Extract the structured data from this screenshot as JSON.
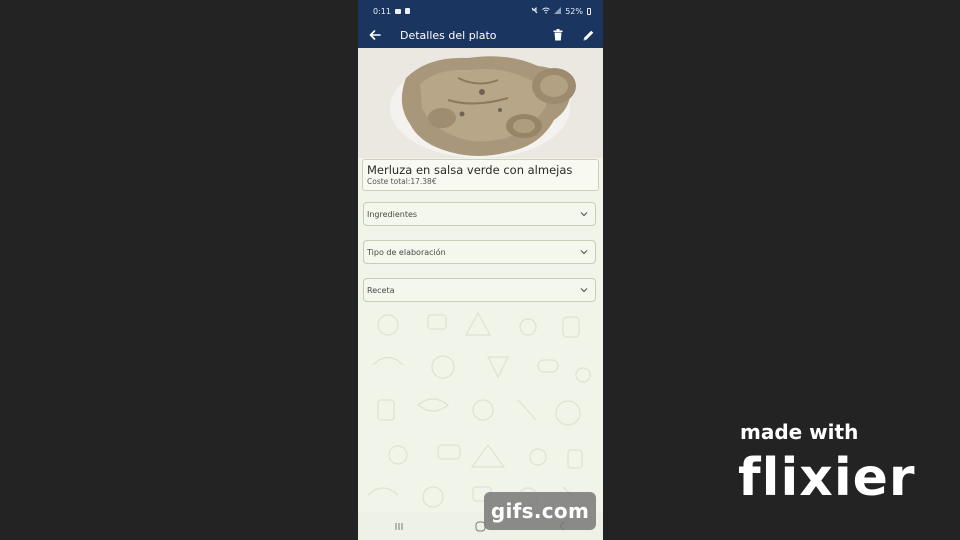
{
  "status_bar": {
    "time": "0:11",
    "battery": "52%"
  },
  "app_bar": {
    "title": "Detalles del plato",
    "back_icon": "arrow-left-icon",
    "delete_icon": "trash-icon",
    "edit_icon": "pencil-icon"
  },
  "dish": {
    "name": "Merluza en salsa verde con almejas",
    "cost": "Coste total:17.38€"
  },
  "sections": [
    {
      "label": "Ingredientes"
    },
    {
      "label": "Tipo de elaboración"
    },
    {
      "label": "Receta"
    }
  ],
  "navigation_bar": {
    "recents_icon": "recents-icon",
    "home_icon": "home-icon",
    "back_icon": "back-chevron-icon"
  },
  "watermarks": {
    "gifs": "gifs.com",
    "made_with": "made with",
    "brand": "flixier"
  },
  "colors": {
    "app_bar": "#1a3560",
    "background": "#f1f4e8",
    "outer": "#232323"
  }
}
